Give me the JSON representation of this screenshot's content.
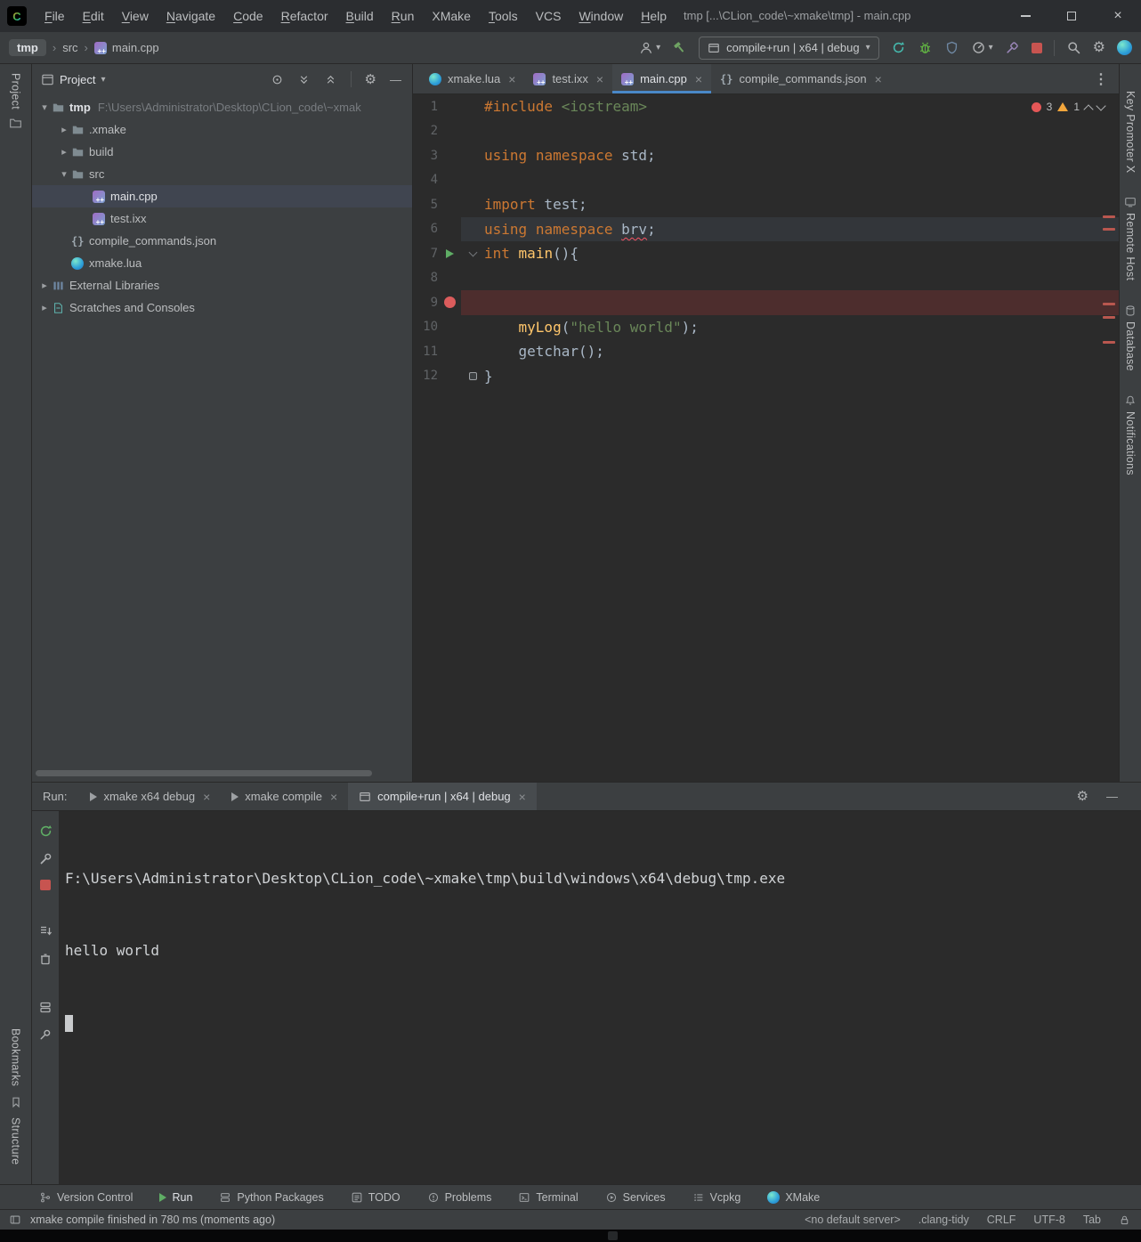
{
  "icons": {
    "gear": "⚙",
    "minus": "—",
    "close": "×",
    "more": "⋮",
    "chevron_down": "▾",
    "chevron_right": "▸",
    "crumb_sep": "›",
    "braces": "{}"
  },
  "window": {
    "title": "tmp [...\\CLion_code\\~xmake\\tmp] - main.cpp",
    "menu": [
      "File",
      "Edit",
      "View",
      "Navigate",
      "Code",
      "Refactor",
      "Build",
      "Run",
      "XMake",
      "Tools",
      "VCS",
      "Window",
      "Help"
    ]
  },
  "toolbar": {
    "breadcrumb": [
      "tmp",
      "src",
      "main.cpp"
    ],
    "run_config": "compile+run | x64 | debug"
  },
  "stripes": {
    "left_top": "Project",
    "left_bottom": [
      "Bookmarks",
      "Structure"
    ],
    "right": [
      "Key Promoter X",
      "Remote Host",
      "Database",
      "Notifications"
    ]
  },
  "project": {
    "header": "Project",
    "tree": [
      {
        "label": "tmp",
        "path": "F:\\Users\\Administrator\\Desktop\\CLion_code\\~xmak"
      },
      {
        "label": ".xmake"
      },
      {
        "label": "build"
      },
      {
        "label": "src"
      },
      {
        "label": "main.cpp"
      },
      {
        "label": "test.ixx"
      },
      {
        "label": "compile_commands.json"
      },
      {
        "label": "xmake.lua"
      },
      {
        "label": "External Libraries"
      },
      {
        "label": "Scratches and Consoles"
      }
    ]
  },
  "tabs": [
    {
      "label": "xmake.lua"
    },
    {
      "label": "test.ixx"
    },
    {
      "label": "main.cpp"
    },
    {
      "label": "compile_commands.json"
    }
  ],
  "editor": {
    "errors": "3",
    "warnings": "1",
    "lines": [
      {
        "no": "1",
        "code": [
          "#include ",
          "<iostream>"
        ]
      },
      {
        "no": "2",
        "code": []
      },
      {
        "no": "3",
        "code": [
          "using",
          " ",
          "namespace",
          " std;"
        ]
      },
      {
        "no": "4",
        "code": []
      },
      {
        "no": "5",
        "code": [
          "import",
          " test;"
        ]
      },
      {
        "no": "6",
        "code": [
          "using",
          " ",
          "namespace",
          " ",
          "brv",
          ";"
        ]
      },
      {
        "no": "7",
        "code": [
          "int",
          " ",
          "main",
          "(){"
        ]
      },
      {
        "no": "8",
        "code": []
      },
      {
        "no": "9",
        "code": []
      },
      {
        "no": "10",
        "code": [
          "    ",
          "myLog",
          "(",
          "\"hello world\"",
          ");"
        ]
      },
      {
        "no": "11",
        "code": [
          "    getchar();"
        ]
      },
      {
        "no": "12",
        "code": [
          "}"
        ]
      }
    ]
  },
  "run": {
    "label": "Run:",
    "tabs": [
      {
        "label": "xmake x64 debug"
      },
      {
        "label": "xmake compile"
      },
      {
        "label": "compile+run | x64 | debug"
      }
    ],
    "console": [
      "F:\\Users\\Administrator\\Desktop\\CLion_code\\~xmake\\tmp\\build\\windows\\x64\\debug\\tmp.exe",
      "hello world"
    ]
  },
  "toolwindows": [
    "Version Control",
    "Run",
    "Python Packages",
    "TODO",
    "Problems",
    "Terminal",
    "Services",
    "Vcpkg",
    "XMake"
  ],
  "status": {
    "message": "xmake compile finished in 780 ms (moments ago)",
    "items": [
      "<no default server>",
      ".clang-tidy",
      "CRLF",
      "UTF-8",
      "Tab"
    ]
  }
}
